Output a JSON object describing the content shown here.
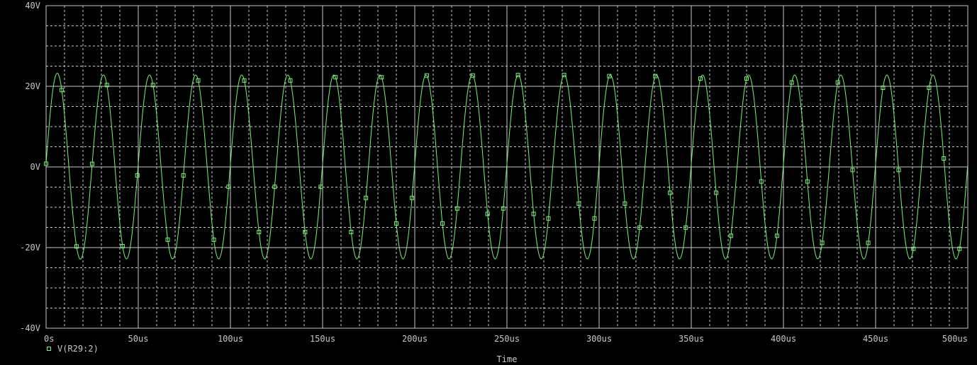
{
  "colors": {
    "background": "#000000",
    "grid": "#c8c8c8",
    "trace": "#7cf07c",
    "text": "#c8c8c8"
  },
  "chart_data": {
    "type": "line",
    "xlabel": "Time",
    "ylabel": "",
    "xlim": [
      0,
      500
    ],
    "ylim": [
      -40,
      40
    ],
    "x_unit": "us",
    "y_unit": "V",
    "x_ticks": [
      0,
      50,
      100,
      150,
      200,
      250,
      300,
      350,
      400,
      450,
      500
    ],
    "x_tick_labels": [
      "0s",
      "50us",
      "100us",
      "150us",
      "200us",
      "250us",
      "300us",
      "350us",
      "400us",
      "450us",
      "500us"
    ],
    "y_ticks": [
      40,
      20,
      0,
      -20,
      -40
    ],
    "y_tick_labels": [
      "40V",
      "20V",
      "0V",
      "-20V",
      "-40V"
    ],
    "grid": true,
    "legend_position": "bottom-left",
    "series": [
      {
        "name": "V(R29:2)",
        "marker": "square",
        "shape": "sine",
        "amplitude": 22.8,
        "first_peak": 24.0,
        "frequency_khz": 40,
        "period_us": 25,
        "start_value": 0.8,
        "marker_x": [
          0,
          8.5,
          16.5,
          25,
          33,
          41.5,
          49.5,
          58,
          66,
          74.5,
          82.5,
          91,
          99,
          107.5,
          115.5,
          124,
          132.5,
          140.5,
          149,
          157,
          165.5,
          173.5,
          182,
          190,
          198.5,
          206.5,
          215,
          223,
          231.5,
          239.5,
          248,
          256,
          264.5,
          272.5,
          281,
          289,
          297.5,
          305.5,
          314,
          322,
          330.5,
          338.5,
          347,
          355,
          363.5,
          371.5,
          380,
          388,
          396.5,
          404.5,
          413,
          421,
          429.5,
          437.5,
          446,
          454,
          462.5,
          470.5,
          479,
          487,
          495.5
        ]
      }
    ]
  }
}
